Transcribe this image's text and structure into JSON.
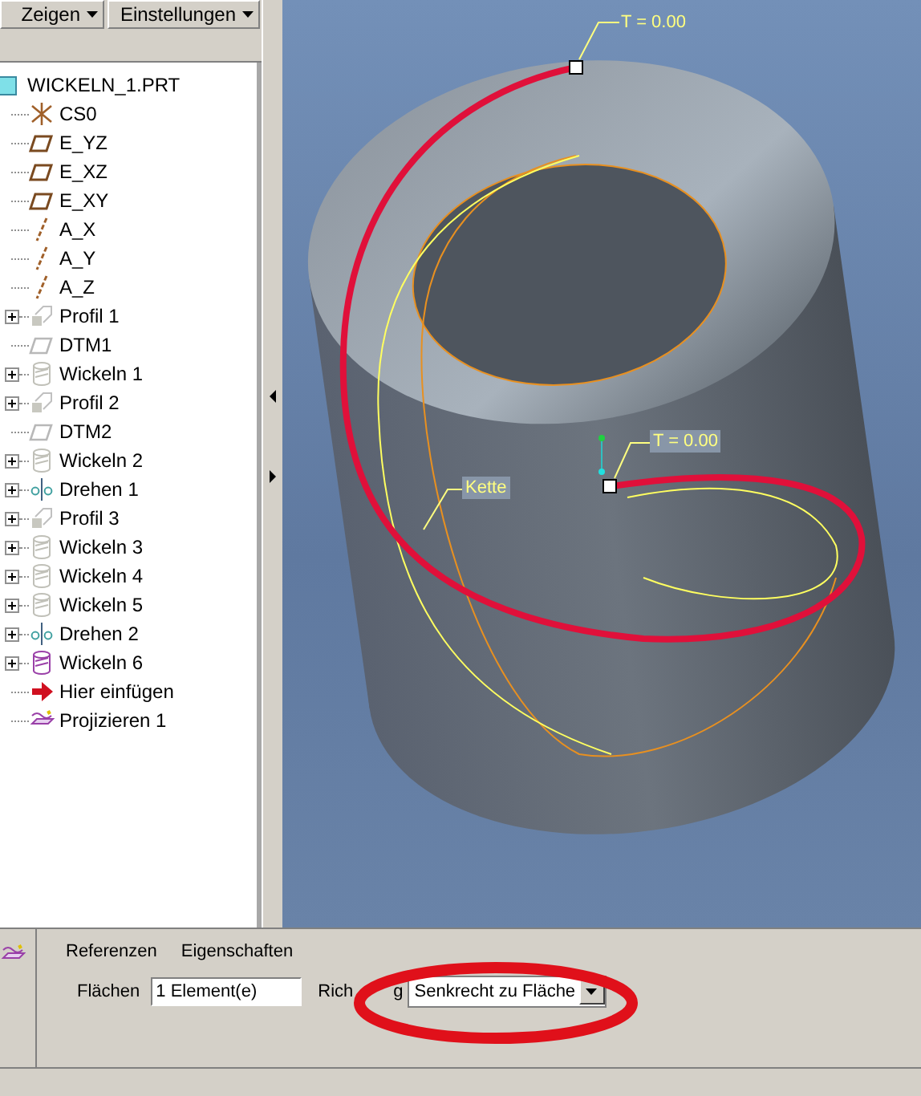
{
  "toolbar": {
    "buttons": [
      "Zeigen",
      "Einstellungen"
    ]
  },
  "tree": {
    "root": "WICKELN_1.PRT",
    "items": [
      {
        "label": "CS0",
        "kind": "csys",
        "expandable": false
      },
      {
        "label": "E_YZ",
        "kind": "plane",
        "expandable": false
      },
      {
        "label": "E_XZ",
        "kind": "plane",
        "expandable": false
      },
      {
        "label": "E_XY",
        "kind": "plane",
        "expandable": false
      },
      {
        "label": "A_X",
        "kind": "axis",
        "expandable": false
      },
      {
        "label": "A_Y",
        "kind": "axis",
        "expandable": false
      },
      {
        "label": "A_Z",
        "kind": "axis",
        "expandable": false
      },
      {
        "label": "Profil 1",
        "kind": "profile",
        "expandable": true
      },
      {
        "label": "DTM1",
        "kind": "datum",
        "expandable": false
      },
      {
        "label": "Wickeln 1",
        "kind": "wrap",
        "expandable": true
      },
      {
        "label": "Profil 2",
        "kind": "profile",
        "expandable": true
      },
      {
        "label": "DTM2",
        "kind": "datum",
        "expandable": false
      },
      {
        "label": "Wickeln 2",
        "kind": "wrap",
        "expandable": true
      },
      {
        "label": "Drehen 1",
        "kind": "revolve",
        "expandable": true
      },
      {
        "label": "Profil 3",
        "kind": "profile",
        "expandable": true
      },
      {
        "label": "Wickeln 3",
        "kind": "wrap",
        "expandable": true
      },
      {
        "label": "Wickeln 4",
        "kind": "wrap",
        "expandable": true
      },
      {
        "label": "Wickeln 5",
        "kind": "wrap",
        "expandable": true
      },
      {
        "label": "Drehen 2",
        "kind": "revolve",
        "expandable": true
      },
      {
        "label": "Wickeln 6",
        "kind": "wrap-active",
        "expandable": true
      },
      {
        "label": "Hier einfügen",
        "kind": "insert",
        "expandable": false
      },
      {
        "label": "Projizieren 1",
        "kind": "project",
        "expandable": false
      }
    ]
  },
  "viewport": {
    "labels": [
      {
        "text": "T = 0.00",
        "kind": "top"
      },
      {
        "text": "T = 0.00",
        "kind": "mid"
      },
      {
        "text": "Kette",
        "kind": "chain"
      }
    ]
  },
  "panel": {
    "tabs": [
      "Referenzen",
      "Eigenschaften"
    ],
    "fields": {
      "surfaces_label": "Flächen",
      "surfaces_value": "1 Element(e)",
      "direction_label_start": "Rich",
      "direction_label_end": "g",
      "direction_value": "Senkrecht zu Fläche"
    }
  }
}
